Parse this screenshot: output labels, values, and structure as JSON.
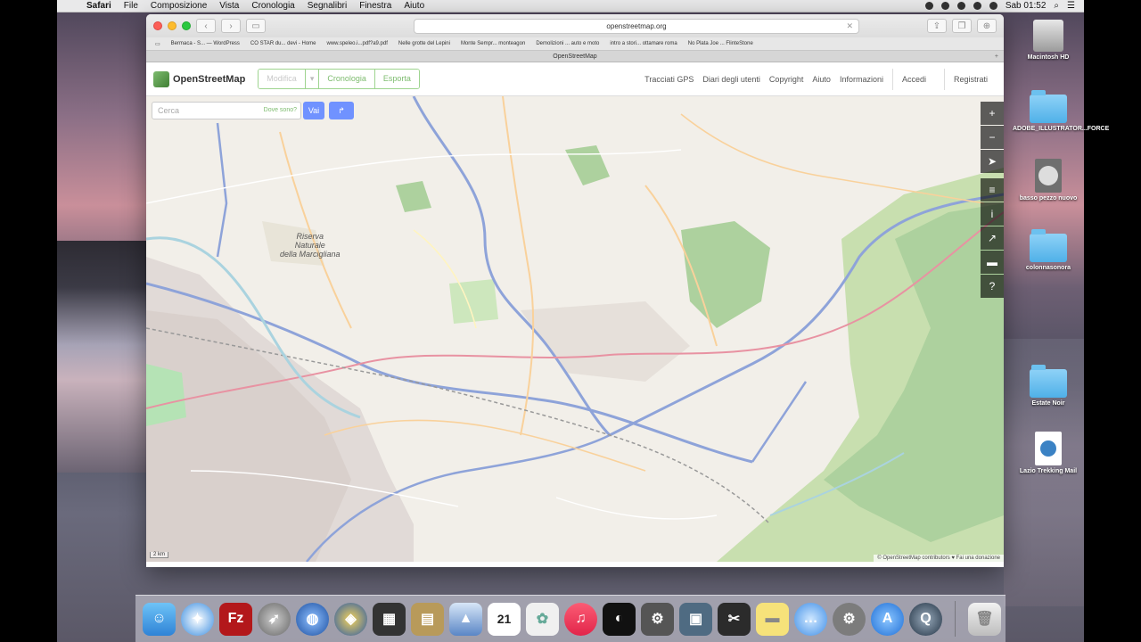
{
  "menubar": {
    "apple_icon": "apple-logo-icon",
    "app": "Safari",
    "items": [
      "File",
      "Composizione",
      "Vista",
      "Cronologia",
      "Segnalibri",
      "Finestra",
      "Aiuto"
    ],
    "clock": "Sab 01:52"
  },
  "browser": {
    "url": "openstreetmap.org",
    "tab_title": "OpenStreetMap",
    "bookmarks": [
      "Bermaca - S... — WordPress",
      "CO STAR du... devi - Home",
      "www.speleo.i...pdf?a9.pdf",
      "Nelle grotte del Lepini",
      "Monte Sempr... monteagon",
      "Demolizioni ... auto e moto",
      "intro a stori... ottamare roma",
      "No Plata Joe ... FlinteStone"
    ]
  },
  "osm": {
    "brand": "OpenStreetMap",
    "modes": {
      "edit": "Modifica",
      "history": "Cronologia",
      "export": "Esporta"
    },
    "nav": [
      "Tracciati GPS",
      "Diari degli utenti",
      "Copyright",
      "Aiuto",
      "Informazioni"
    ],
    "login": "Accedi",
    "signup": "Registrati",
    "search_placeholder": "Cerca",
    "where_am_i": "Dove sono?",
    "go": "Vai",
    "attribution": "© OpenStreetMap contributors ♥ Fai una donazione",
    "scale_label": "2 km"
  },
  "map_labels": {
    "reserve_line1": "Riserva",
    "reserve_line2": "Naturale",
    "reserve_line3": "della Marcigliana"
  },
  "desktop": {
    "icons": [
      {
        "label": "Macintosh HD",
        "icon": "hard-drive-icon"
      },
      {
        "label": "ADOBE_ILLUSTRATOR...FORCE",
        "icon": "folder-icon"
      },
      {
        "label": "basso pezzo nuovo",
        "icon": "disc-icon"
      },
      {
        "label": "colonnasonora",
        "icon": "folder-icon"
      },
      {
        "label": "Estate Noir",
        "icon": "folder-icon"
      },
      {
        "label": "Lazio Trekking Mail",
        "icon": "document-icon"
      }
    ]
  },
  "dock": {
    "items": [
      "finder-icon",
      "safari-icon",
      "filezilla-icon",
      "launchpad-icon",
      "google-earth-icon",
      "compass-icon",
      "photo-booth-icon",
      "notes-icon",
      "preview-icon",
      "calendar-icon",
      "photos-icon",
      "itunes-icon",
      "logic-icon",
      "gpu-icon",
      "image-capture-icon",
      "final-cut-icon",
      "stickies-icon",
      "messages-icon",
      "system-preferences-icon",
      "app-store-icon",
      "quicktime-icon",
      "trash-icon"
    ],
    "calendar_day": "21"
  },
  "colors": {
    "osm_green": "#7ebc6f",
    "osm_blue_button": "#7092ff",
    "map_bg": "#f2efe9",
    "forest": "#add19e",
    "road_blue": "#8ea3d9"
  }
}
